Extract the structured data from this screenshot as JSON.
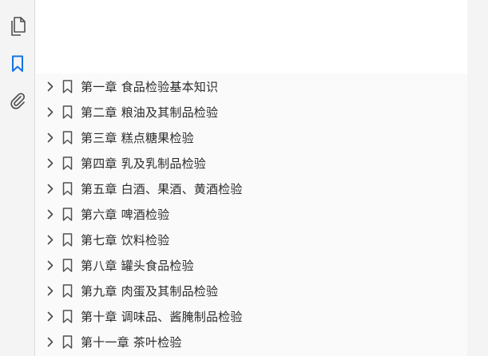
{
  "sidebar_rail": {
    "items": [
      {
        "icon": "pages-icon",
        "active": false
      },
      {
        "icon": "bookmark-icon",
        "active": true
      },
      {
        "icon": "attachment-icon",
        "active": false
      }
    ],
    "accent_color": "#1473e6"
  },
  "bookmarks": {
    "items": [
      {
        "label": "第一章  食品检验基本知识"
      },
      {
        "label": "第二章  粮油及其制品检验"
      },
      {
        "label": "第三章  糕点糖果检验"
      },
      {
        "label": "第四章  乳及乳制品检验"
      },
      {
        "label": "第五章  白酒、果酒、黄酒检验"
      },
      {
        "label": "第六章  啤酒检验"
      },
      {
        "label": "第七章  饮料检验"
      },
      {
        "label": "第八章  罐头食品检验"
      },
      {
        "label": "第九章  肉蛋及其制品检验"
      },
      {
        "label": "第十章  调味品、酱腌制品检验"
      },
      {
        "label": "第十一章  茶叶检验"
      }
    ]
  }
}
